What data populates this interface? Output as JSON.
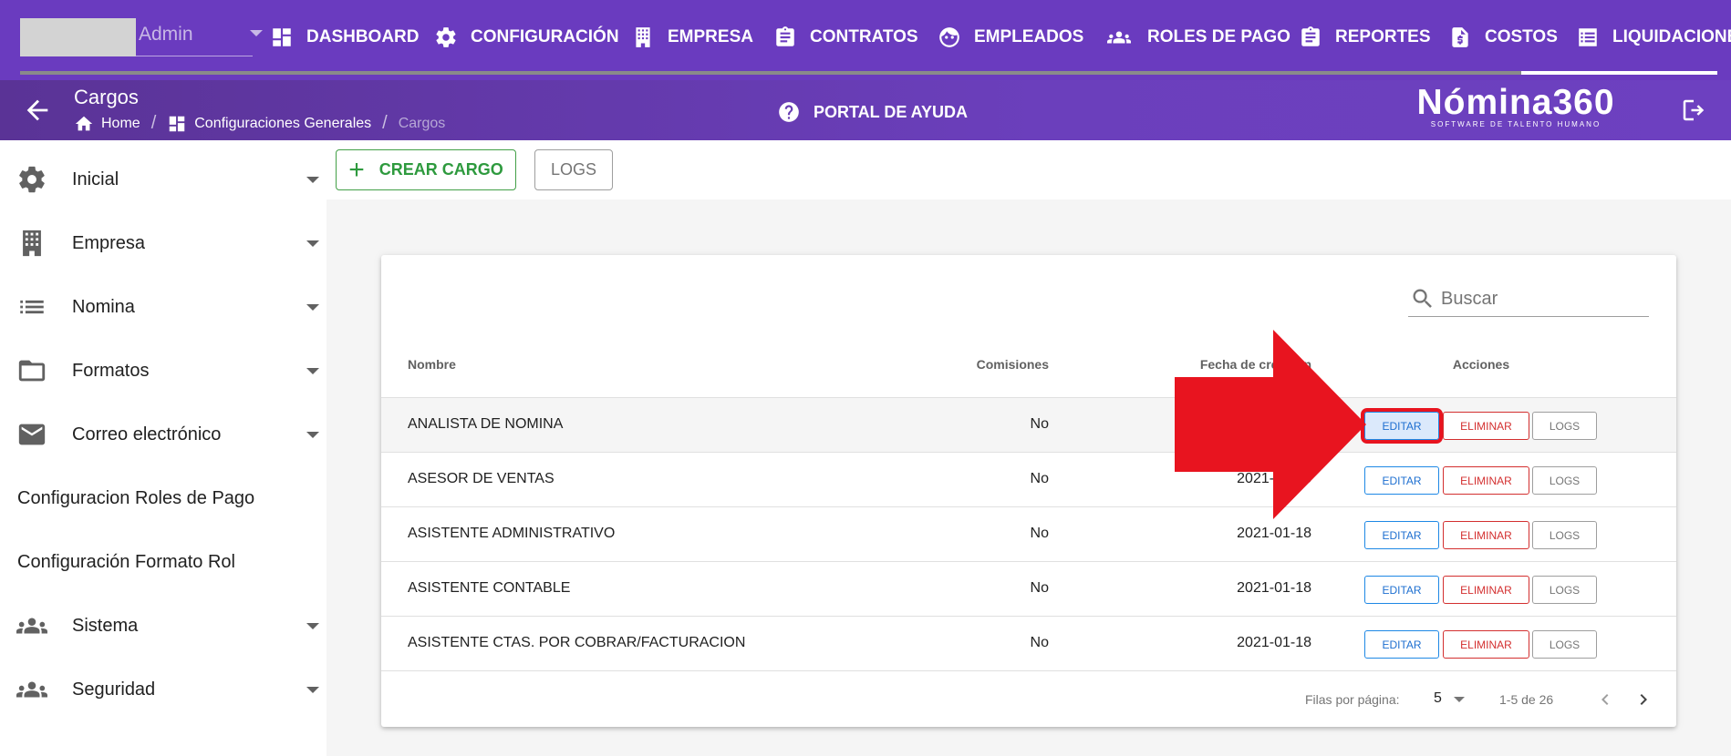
{
  "topnav": {
    "user_label": "Admin",
    "items": [
      {
        "label": "DASHBOARD",
        "icon": "dashboard-icon"
      },
      {
        "label": "CONFIGURACIÓN",
        "icon": "gear-icon"
      },
      {
        "label": "EMPRESA",
        "icon": "building-icon"
      },
      {
        "label": "CONTRATOS",
        "icon": "clipboard-icon"
      },
      {
        "label": "EMPLEADOS",
        "icon": "face-icon"
      },
      {
        "label": "ROLES DE PAGO",
        "icon": "group-icon"
      },
      {
        "label": "REPORTES",
        "icon": "clipboard-icon"
      },
      {
        "label": "COSTOS",
        "icon": "dollar-file-icon"
      },
      {
        "label": "LIQUIDACIONE",
        "icon": "list-icon"
      }
    ]
  },
  "subheader": {
    "title": "Cargos",
    "breadcrumb": [
      "Home",
      "Configuraciones Generales",
      "Cargos"
    ],
    "help": "PORTAL DE AYUDA",
    "brand": "Nómina360",
    "brand_tagline": "SOFTWARE DE TALENTO HUMANO"
  },
  "sidebar": {
    "items": [
      {
        "label": "Inicial",
        "icon": "gear-icon"
      },
      {
        "label": "Empresa",
        "icon": "building-icon"
      },
      {
        "label": "Nomina",
        "icon": "list-icon"
      },
      {
        "label": "Formatos",
        "icon": "folder-icon"
      },
      {
        "label": "Correo electrónico",
        "icon": "mail-icon"
      },
      {
        "label": "Configuracion Roles de Pago"
      },
      {
        "label": "Configuración Formato Rol"
      },
      {
        "label": "Sistema",
        "icon": "group-icon"
      },
      {
        "label": "Seguridad",
        "icon": "group-icon"
      }
    ]
  },
  "toolbar": {
    "create_label": "CREAR CARGO",
    "logs_label": "LOGS"
  },
  "table": {
    "search_placeholder": "Buscar",
    "headers": {
      "name": "Nombre",
      "commissions": "Comisiones",
      "created": "Fecha de creación",
      "actions": "Acciones"
    },
    "action_labels": {
      "edit": "EDITAR",
      "delete": "ELIMINAR",
      "logs": "LOGS"
    },
    "rows": [
      {
        "name": "ANALISTA DE NOMINA",
        "commissions": "No",
        "created": ""
      },
      {
        "name": "ASESOR DE VENTAS",
        "commissions": "No",
        "created": "2021-01-18"
      },
      {
        "name": "ASISTENTE ADMINISTRATIVO",
        "commissions": "No",
        "created": "2021-01-18"
      },
      {
        "name": "ASISTENTE CONTABLE",
        "commissions": "No",
        "created": "2021-01-18"
      },
      {
        "name": "ASISTENTE CTAS. POR COBRAR/FACTURACION",
        "commissions": "No",
        "created": "2021-01-18"
      }
    ],
    "footer": {
      "rows_per_page_label": "Filas por página:",
      "rows_per_page": "5",
      "range": "1-5 de 26"
    }
  },
  "colors": {
    "brand_purple": "#6a3bbf",
    "create_green": "#2e9a3e",
    "edit_blue": "#1e6fd0",
    "delete_red": "#d32f2f",
    "annotation_red": "#e8141f"
  }
}
